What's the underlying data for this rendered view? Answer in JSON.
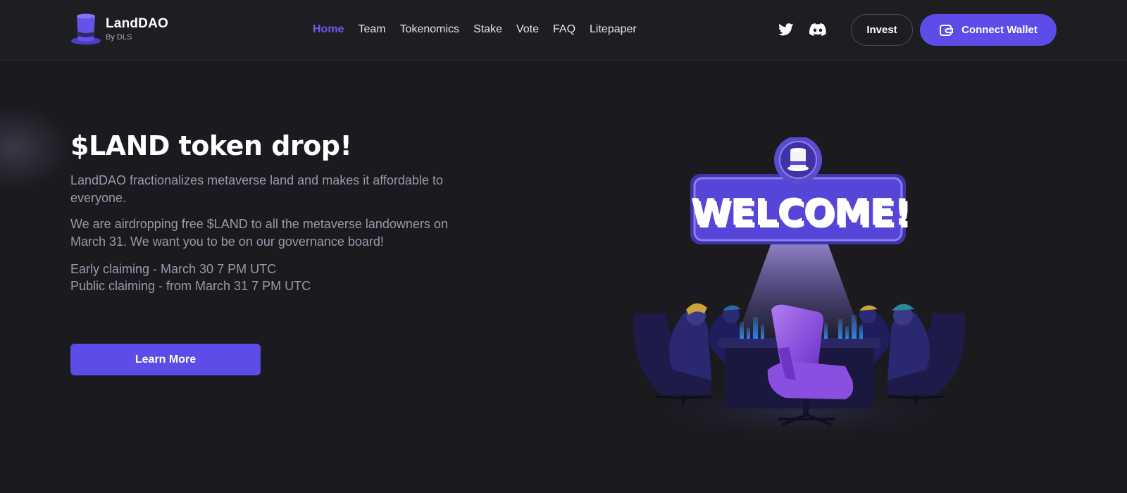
{
  "header": {
    "logo_title": "LandDAO",
    "logo_subtitle": "By DLS",
    "nav": [
      {
        "label": "Home",
        "active": true
      },
      {
        "label": "Team",
        "active": false
      },
      {
        "label": "Tokenomics",
        "active": false
      },
      {
        "label": "Stake",
        "active": false
      },
      {
        "label": "Vote",
        "active": false
      },
      {
        "label": "FAQ",
        "active": false
      },
      {
        "label": "Litepaper",
        "active": false
      }
    ],
    "social": [
      "twitter-icon",
      "discord-icon"
    ],
    "invest_label": "Invest",
    "connect_wallet_label": "Connect Wallet"
  },
  "hero": {
    "title": "$LAND token drop!",
    "paragraph1": "LandDAO fractionalizes metaverse land and makes it affordable to everyone.",
    "paragraph2": "We are airdropping free $LAND to all the metaverse landowners on March 31. We want you to be on our governance board!",
    "early_claiming": "Early claiming - March 30 7 PM UTC",
    "public_claiming": "Public claiming - from March 31 7 PM UTC",
    "learn_more_label": "Learn More"
  },
  "illustration": {
    "sign_text": "WELCOME!"
  },
  "colors": {
    "background": "#1b1a1f",
    "header_background": "#1e1d22",
    "accent": "#5c4ce8",
    "nav_active": "#6a5cf0",
    "body_text": "#9a99ac"
  }
}
